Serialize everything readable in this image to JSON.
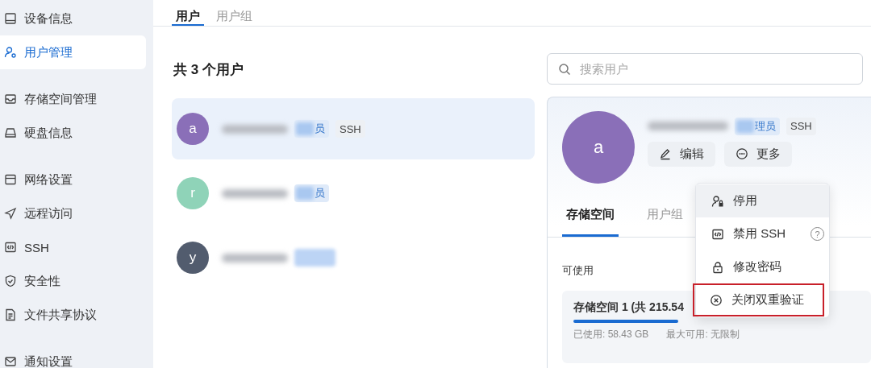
{
  "sidebar": {
    "groups": [
      [
        {
          "label": "设备信息",
          "selected": false
        },
        {
          "label": "用户管理",
          "selected": true
        }
      ],
      [
        {
          "label": "存储空间管理",
          "selected": false
        },
        {
          "label": "硬盘信息",
          "selected": false
        }
      ],
      [
        {
          "label": "网络设置",
          "selected": false
        },
        {
          "label": "远程访问",
          "selected": false
        },
        {
          "label": "SSH",
          "selected": false
        },
        {
          "label": "安全性",
          "selected": false
        },
        {
          "label": "文件共享协议",
          "selected": false
        }
      ],
      [
        {
          "label": "通知设置",
          "selected": false
        }
      ]
    ]
  },
  "tabs": [
    {
      "label": "用户",
      "selected": true
    },
    {
      "label": "用户组",
      "selected": false
    }
  ],
  "user_count": "共 3 个用户",
  "search": {
    "placeholder": "搜索用户"
  },
  "users": [
    {
      "avatar": "a",
      "color": "#8a6fb8",
      "name_redacted": true,
      "selected": true,
      "tags": [
        {
          "kind": "role",
          "text": "员"
        },
        {
          "kind": "plain",
          "text": "SSH"
        }
      ]
    },
    {
      "avatar": "r",
      "color": "#8fd3b8",
      "name_redacted": true,
      "selected": false,
      "tags": [
        {
          "kind": "role",
          "text": "员"
        }
      ]
    },
    {
      "avatar": "y",
      "color": "#525c6e",
      "name_redacted": true,
      "selected": false,
      "tags": [
        {
          "kind": "role-hidden"
        }
      ]
    }
  ],
  "detail": {
    "avatar": "a",
    "color": "#8a6fb8",
    "name_redacted": true,
    "tags": [
      {
        "kind": "role",
        "text": "理员"
      },
      {
        "kind": "plain",
        "text": "SSH"
      }
    ],
    "buttons": [
      {
        "kind": "edit",
        "label": "编辑"
      },
      {
        "kind": "more",
        "label": "更多"
      }
    ],
    "tabs": [
      {
        "label": "存储空间",
        "selected": true
      },
      {
        "label": "用户组",
        "selected": false
      }
    ],
    "section_label": "可使用",
    "storage": {
      "title": "存储空间 1 (共 215.54",
      "used": "已使用: 58.43 GB",
      "max": "最大可用: 无限制"
    }
  },
  "menu": [
    {
      "kind": "user-lock",
      "label": "停用",
      "hovered": true,
      "highlighted": false
    },
    {
      "kind": "code",
      "label": "禁用 SSH",
      "help": "?",
      "hovered": false,
      "highlighted": false
    },
    {
      "kind": "lock",
      "label": "修改密码",
      "hovered": false,
      "highlighted": false
    },
    {
      "kind": "close-circle",
      "label": "关闭双重验证",
      "hovered": false,
      "highlighted": true
    }
  ]
}
